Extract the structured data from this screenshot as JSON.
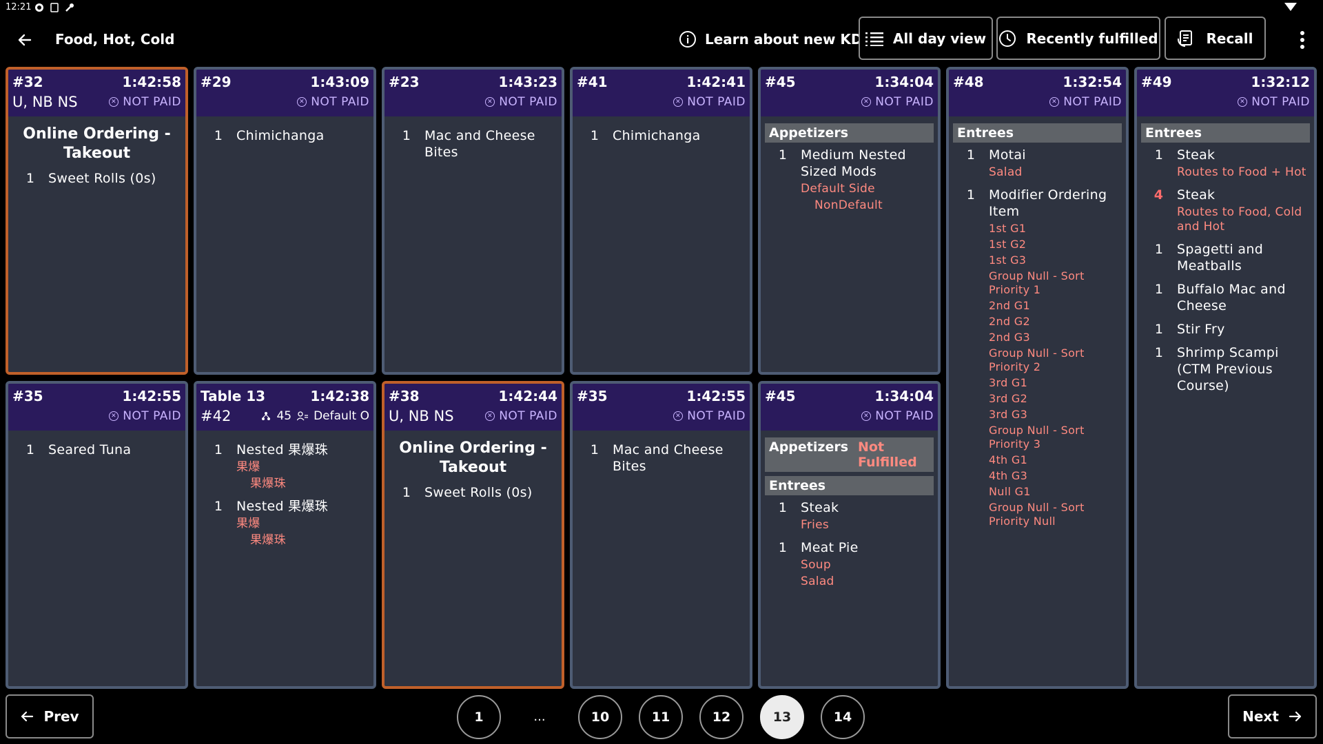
{
  "status": {
    "time": "12:21"
  },
  "header": {
    "title": "Food, Hot, Cold",
    "learn_label": "Learn about new KDS",
    "all_day_label": "All day view",
    "recently_label": "Recently fulfilled",
    "recall_label": "Recall"
  },
  "tickets": {
    "t1": {
      "id": "#32",
      "time": "1:42:58",
      "sub": "U, NB NS",
      "paid": "NOT PAID",
      "title": "Online Ordering - Takeout",
      "items": [
        {
          "qty": "1",
          "name": "Sweet Rolls (0s)"
        }
      ]
    },
    "t2": {
      "id": "#29",
      "time": "1:43:09",
      "paid": "NOT PAID",
      "items": [
        {
          "qty": "1",
          "name": "Chimichanga"
        }
      ]
    },
    "t3": {
      "id": "#23",
      "time": "1:43:23",
      "paid": "NOT PAID",
      "items": [
        {
          "qty": "1",
          "name": "Mac and Cheese Bites"
        }
      ]
    },
    "t4": {
      "id": "#41",
      "time": "1:42:41",
      "paid": "NOT PAID",
      "items": [
        {
          "qty": "1",
          "name": "Chimichanga"
        }
      ]
    },
    "t5": {
      "id": "#45",
      "time": "1:34:04",
      "paid": "NOT PAID",
      "course": "Appetizers",
      "items": [
        {
          "qty": "1",
          "name": "Medium Nested Sized Mods",
          "mods": [
            "Default Side",
            "NonDefault"
          ]
        }
      ]
    },
    "t6": {
      "id": "#48",
      "time": "1:32:54",
      "paid": "NOT PAID",
      "course": "Entrees",
      "items": [
        {
          "qty": "1",
          "name": "Motai",
          "mods": [
            "Salad"
          ]
        },
        {
          "qty": "1",
          "name": "Modifier Ordering Item",
          "mods": [
            "1st G1",
            "1st G2",
            "1st G3",
            "Group Null - Sort Priority 1",
            "2nd G1",
            "2nd G2",
            "2nd G3",
            "Group Null - Sort Priority 2",
            "3rd G1",
            "3rd G2",
            "3rd G3",
            "Group Null - Sort Priority 3",
            "4th G1",
            "4th G3",
            "Null G1",
            "Group Null - Sort Priority Null"
          ]
        }
      ]
    },
    "t7": {
      "id": "#49",
      "time": "1:32:12",
      "paid": "NOT PAID",
      "course": "Entrees",
      "items": [
        {
          "qty": "1",
          "name": "Steak",
          "mods": [
            "Routes to Food + Hot"
          ]
        },
        {
          "qty": "4",
          "name": "Steak",
          "mods": [
            "Routes to Food, Cold and Hot"
          ]
        },
        {
          "qty": "1",
          "name": "Spagetti and Meatballs"
        },
        {
          "qty": "1",
          "name": "Buffalo Mac and Cheese"
        },
        {
          "qty": "1",
          "name": "Stir Fry"
        },
        {
          "qty": "1",
          "name": "Shrimp Scampi (CTM Previous Course)"
        }
      ]
    },
    "b1": {
      "id": "#35",
      "time": "1:42:55",
      "paid": "NOT PAID",
      "items": [
        {
          "qty": "1",
          "name": "Seared Tuna"
        }
      ]
    },
    "b2": {
      "id": "Table 13",
      "time": "1:42:38",
      "check": "#42",
      "guests": "45",
      "server": "Default O",
      "items": [
        {
          "qty": "1",
          "name": "Nested 果爆珠",
          "mod1": "果爆",
          "mod2": "果爆珠"
        },
        {
          "qty": "1",
          "name": "Nested 果爆珠",
          "mod1": "果爆",
          "mod2": "果爆珠"
        }
      ]
    },
    "b3": {
      "id": "#38",
      "time": "1:42:44",
      "sub": "U, NB NS",
      "paid": "NOT PAID",
      "title": "Online Ordering - Takeout",
      "items": [
        {
          "qty": "1",
          "name": "Sweet Rolls (0s)"
        }
      ]
    },
    "b4": {
      "id": "#35",
      "time": "1:42:55",
      "paid": "NOT PAID",
      "items": [
        {
          "qty": "1",
          "name": "Mac and Cheese Bites"
        }
      ]
    },
    "b5": {
      "id": "#45",
      "time": "1:34:04",
      "paid": "NOT PAID",
      "course1": "Appetizers",
      "course1_status": "Not Fulfilled",
      "course2": "Entrees",
      "items": [
        {
          "qty": "1",
          "name": "Steak",
          "mods": [
            "Fries"
          ]
        },
        {
          "qty": "1",
          "name": "Meat Pie",
          "mods": [
            "Soup",
            "Salad"
          ]
        }
      ]
    }
  },
  "pagination": {
    "prev_label": "Prev",
    "next_label": "Next",
    "pages": [
      "1",
      "...",
      "10",
      "11",
      "12",
      "13",
      "14"
    ],
    "current": "13"
  }
}
